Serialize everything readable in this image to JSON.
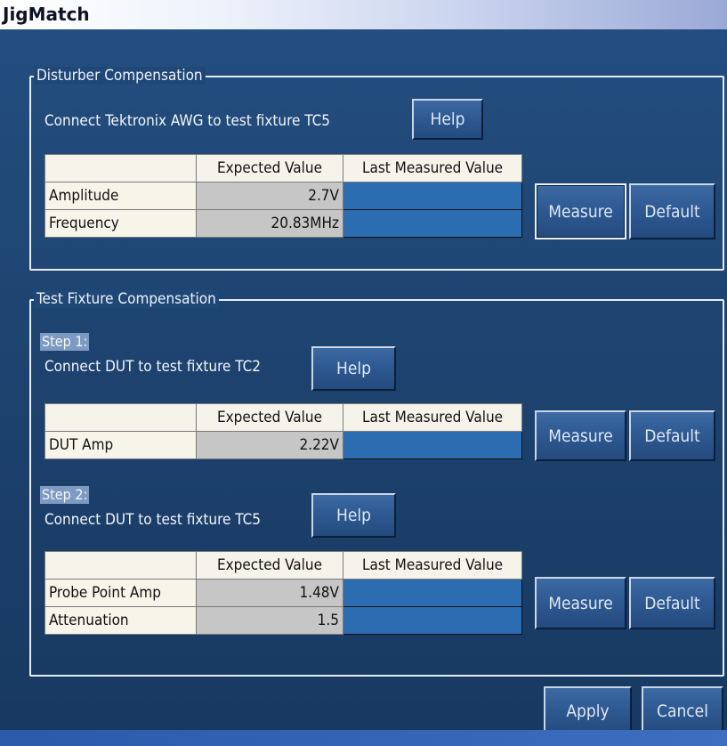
{
  "window": {
    "title": "JigMatch"
  },
  "disturber": {
    "legend": "Disturber Compensation",
    "instruction": "Connect Tektronix AWG to test fixture TC5",
    "help_label": "Help",
    "headers": [
      "",
      "Expected Value",
      "Last Measured Value"
    ],
    "rows": [
      {
        "label": "Amplitude",
        "expected": "2.7V",
        "measured": ""
      },
      {
        "label": "Frequency",
        "expected": "20.83MHz",
        "measured": ""
      }
    ],
    "measure_label": "Measure",
    "default_label": "Default"
  },
  "fixture": {
    "legend": "Test Fixture Compensation",
    "step1": {
      "label": "Step 1:",
      "instruction": "Connect DUT to test fixture TC2",
      "help_label": "Help",
      "headers": [
        "",
        "Expected Value",
        "Last Measured Value"
      ],
      "rows": [
        {
          "label": "DUT Amp",
          "expected": "2.22V",
          "measured": ""
        }
      ],
      "measure_label": "Measure",
      "default_label": "Default"
    },
    "step2": {
      "label": "Step 2:",
      "instruction": "Connect DUT to test fixture TC5",
      "help_label": "Help",
      "headers": [
        "",
        "Expected Value",
        "Last Measured Value"
      ],
      "rows": [
        {
          "label": "Probe Point Amp",
          "expected": "1.48V",
          "measured": ""
        },
        {
          "label": "Attenuation",
          "expected": "1.5",
          "measured": ""
        }
      ],
      "measure_label": "Measure",
      "default_label": "Default"
    }
  },
  "footer": {
    "apply_label": "Apply",
    "cancel_label": "Cancel"
  },
  "colors": {
    "background": "#1d426e",
    "measured_cell": "#2c6db2",
    "expected_cell": "#c6c6c6",
    "step_highlight": "#7d9ac2"
  }
}
